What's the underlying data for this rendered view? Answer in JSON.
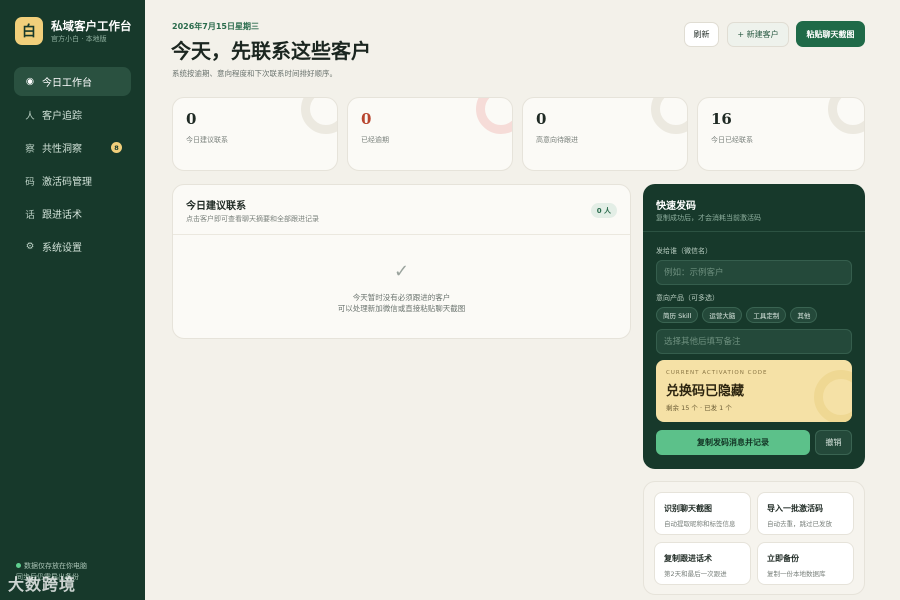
{
  "sidebar": {
    "logo_char": "白",
    "brand_title": "私域客户工作台",
    "brand_sub": "官方小白 · 本地版",
    "items": [
      {
        "icon": "◉",
        "label": "今日工作台",
        "active": true
      },
      {
        "icon": "人",
        "label": "客户追踪"
      },
      {
        "icon": "察",
        "label": "共性洞察",
        "badge": "8"
      },
      {
        "icon": "码",
        "label": "激活码管理"
      },
      {
        "icon": "话",
        "label": "跟进话术"
      },
      {
        "icon": "⚙",
        "label": "系统设置"
      }
    ],
    "footer_line1": "数据仅存放在你电脑",
    "footer_line2": "同步后仍需导出备份",
    "watermark": "大数跨境"
  },
  "header": {
    "date": "2026年7月15日星期三",
    "title": "今天，先联系这些客户",
    "subtitle": "系统按逾期、意向程度和下次联系时间排好顺序。",
    "refresh_label": "刷新",
    "new_label": "+ 新建客户",
    "paste_label": "粘贴聊天截图"
  },
  "stats": [
    {
      "value": "0",
      "label": "今日建议联系"
    },
    {
      "value": "0",
      "label": "已经逾期"
    },
    {
      "value": "0",
      "label": "高意向待跟进"
    },
    {
      "value": "16",
      "label": "今日已经联系"
    }
  ],
  "today": {
    "title": "今日建议联系",
    "subtitle": "点击客户即可查看聊天摘要和全部跟进记录",
    "count": "0 人",
    "empty_icon": "✓",
    "empty_line1": "今天暂时没有必须跟进的客户",
    "empty_line2": "可以处理新加微信或直接粘贴聊天截图"
  },
  "quick": {
    "title": "快速发码",
    "subtitle": "复制成功后，才会消耗当前激活码",
    "recipient_label": "发给谁（微信名）",
    "recipient_placeholder": "例如：示例客户",
    "product_label": "意向产品（可多选）",
    "products": [
      "简历 Skill",
      "运营大脑",
      "工具定制",
      "其他"
    ],
    "note_placeholder": "选择其他后填写备注",
    "code_label": "CURRENT ACTIVATION CODE",
    "code_title": "兑换码已隐藏",
    "code_meta": "剩余 15 个 · 已发 1 个",
    "copy_label": "复制发码消息并记录",
    "undo_label": "撤销"
  },
  "shortcuts": [
    {
      "title": "识别聊天截图",
      "sub": "自动提取昵称和标签信息"
    },
    {
      "title": "导入一批激活码",
      "sub": "自动去重，跳过已发放"
    },
    {
      "title": "复制跟进话术",
      "sub": "第2天和最后一次跟进"
    },
    {
      "title": "立即备份",
      "sub": "复制一份本地数据库"
    }
  ]
}
